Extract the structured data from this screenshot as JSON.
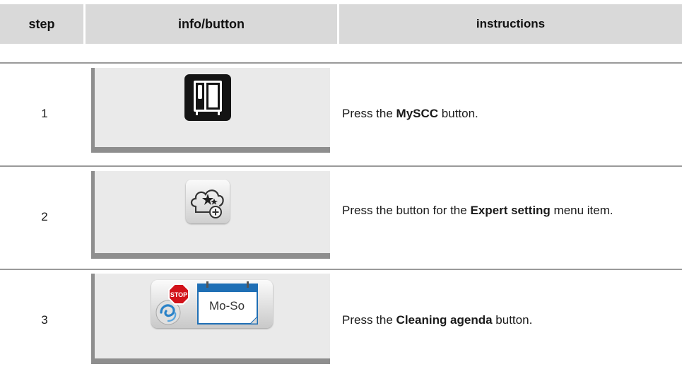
{
  "header": {
    "step": "step",
    "info": "info/button",
    "instructions": "instructions"
  },
  "rows": [
    {
      "step": "1",
      "icon": "myscc-oven-icon",
      "pre": "Press the ",
      "bold": "MySCC",
      "post": " button."
    },
    {
      "step": "2",
      "icon": "expert-setting-cloud-icon",
      "pre": "Press the button for the ",
      "bold": "Expert setting",
      "post": " menu item."
    },
    {
      "step": "3",
      "icon": "cleaning-agenda-icon",
      "stop_text": "STOP",
      "calendar_text": "Mo-So",
      "pre": "Press the ",
      "bold": "Cleaning agenda",
      "post": " button."
    }
  ],
  "colors": {
    "header_bg": "#d9d9d9",
    "panel_bg": "#eaeaea",
    "panel_border": "#8e8e8e",
    "stop_red": "#d2121a",
    "calendar_blue": "#1f6fb5"
  }
}
